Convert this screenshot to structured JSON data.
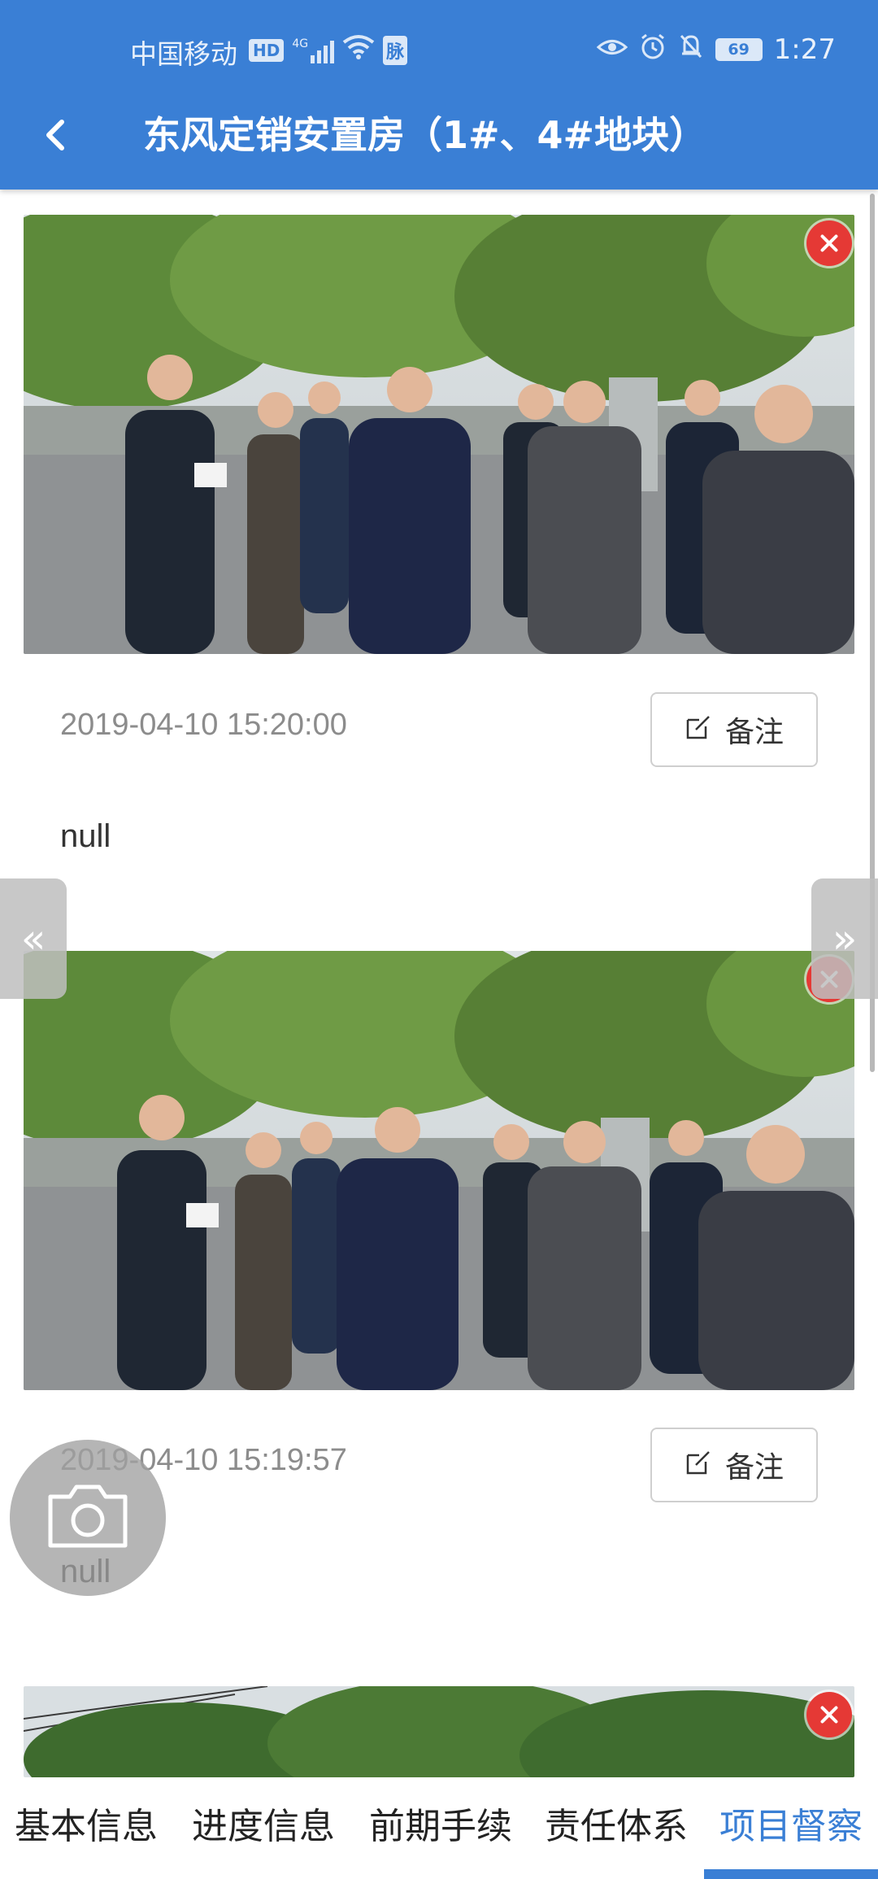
{
  "status_bar": {
    "carrier": "中国移动",
    "hd": "HD",
    "network": "4G",
    "mai": "脉",
    "battery": "69",
    "time": "1:27"
  },
  "header": {
    "title": "东风定销安置房（1#、4#地块）"
  },
  "entries": [
    {
      "timestamp": "2019-04-10 15:20:00",
      "note_label": "备注",
      "note": "null"
    },
    {
      "timestamp": "2019-04-10 15:19:57",
      "note_label": "备注",
      "note": "null"
    }
  ],
  "side_nav": {
    "prev": "«",
    "next": "»"
  },
  "tabs": [
    {
      "label": "基本信息"
    },
    {
      "label": "进度信息"
    },
    {
      "label": "前期手续"
    },
    {
      "label": "责任体系"
    },
    {
      "label": "项目督察"
    }
  ],
  "active_tab": "项目督察",
  "colors": {
    "brand": "#3a7fd5",
    "delete": "#e53935"
  }
}
